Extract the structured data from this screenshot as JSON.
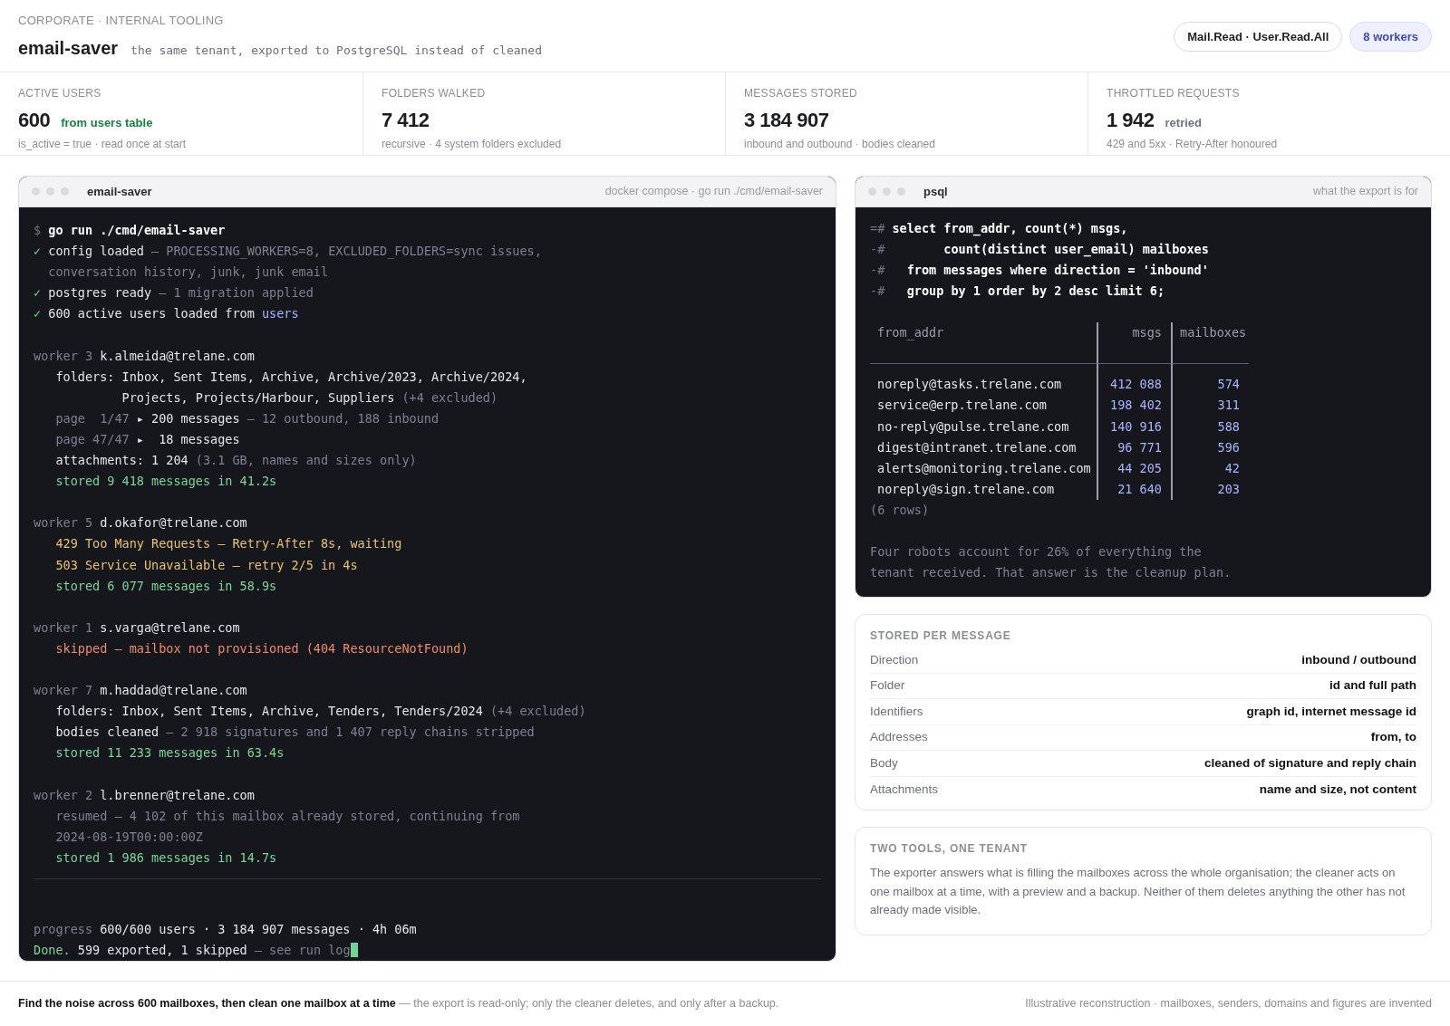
{
  "header": {
    "eyebrow": "CORPORATE · INTERNAL TOOLING",
    "title": "email-saver",
    "subtitle": "the same tenant, exported to PostgreSQL instead of cleaned",
    "badges": [
      {
        "label": "Mail.Read · User.Read.All",
        "kind": "neutral"
      },
      {
        "label": "8 workers",
        "kind": "accent"
      }
    ]
  },
  "stats": [
    {
      "label": "ACTIVE USERS",
      "value": "600",
      "tag": {
        "text": "from users table",
        "kind": "ok"
      },
      "sub": "is_active = true · read once at start"
    },
    {
      "label": "FOLDERS WALKED",
      "value": "7 412",
      "sub": "recursive · 4 system folders excluded"
    },
    {
      "label": "MESSAGES STORED",
      "value": "3 184 907",
      "sub": "inbound and outbound · bodies cleaned"
    },
    {
      "label": "THROTTLED REQUESTS",
      "value": "1 942",
      "tag": {
        "text": "retried",
        "kind": "muted"
      },
      "sub": "429 and 5xx · Retry-After honoured"
    }
  ],
  "terminal": {
    "title": "email-saver",
    "caption": "docker compose · go run ./cmd/email-saver",
    "blocks": [
      {
        "kind": "log",
        "lines": [
          {
            "kind": "top",
            "segments": [
              {
                "text": "$ ",
                "kind": "prompt"
              },
              {
                "text": "go run ./cmd/email-saver",
                "kind": "cmd"
              }
            ]
          },
          {
            "kind": "top",
            "segments": [
              {
                "text": "✓ ",
                "kind": "ok"
              },
              {
                "text": "config loaded ",
                "kind": "text"
              },
              {
                "text": "— PROCESSING_WORKERS=8, EXCLUDED_FOLDERS=sync issues,",
                "kind": "dim"
              }
            ]
          },
          {
            "kind": "wrap",
            "segments": [
              {
                "text": "conversation history, junk, junk email",
                "kind": "dim"
              }
            ]
          },
          {
            "kind": "top",
            "segments": [
              {
                "text": "✓ ",
                "kind": "ok"
              },
              {
                "text": "postgres ready ",
                "kind": "text"
              },
              {
                "text": "— 1 migration applied",
                "kind": "dim"
              }
            ]
          },
          {
            "kind": "top",
            "segments": [
              {
                "text": "✓ ",
                "kind": "ok"
              },
              {
                "text": "600 active users loaded from ",
                "kind": "text"
              },
              {
                "text": "users",
                "kind": "link"
              }
            ]
          }
        ]
      },
      {
        "kind": "log",
        "lines": [
          {
            "kind": "top",
            "segments": [
              {
                "text": "worker 3 ",
                "kind": "dim"
              },
              {
                "text": "k.almeida@trelane.com",
                "kind": "text"
              }
            ]
          },
          {
            "kind": "sub",
            "segments": [
              {
                "text": "folders: Inbox, Sent Items, Archive, Archive/2023, Archive/2024,",
                "kind": "text"
              }
            ]
          },
          {
            "kind": "subwrap",
            "segments": [
              {
                "text": "Projects, Projects/Harbour, Suppliers ",
                "kind": "text"
              },
              {
                "text": "(+4 excluded)",
                "kind": "dim"
              }
            ]
          },
          {
            "kind": "sub",
            "segments": [
              {
                "text": "page  1/47 ",
                "kind": "dim"
              },
              {
                "text": "▸ 200 messages ",
                "kind": "text"
              },
              {
                "text": "— 12 outbound, 188 inbound",
                "kind": "dim"
              }
            ]
          },
          {
            "kind": "sub",
            "segments": [
              {
                "text": "page 47/47 ",
                "kind": "dim"
              },
              {
                "text": "▸  18 messages",
                "kind": "text"
              }
            ]
          },
          {
            "kind": "sub",
            "segments": [
              {
                "text": "attachments: 1 204 ",
                "kind": "text"
              },
              {
                "text": "(3.1 GB, names and sizes only)",
                "kind": "dim"
              }
            ]
          },
          {
            "kind": "sub",
            "segments": [
              {
                "text": "stored 9 418 messages in 41.2s",
                "kind": "ok"
              }
            ]
          }
        ]
      },
      {
        "kind": "log",
        "lines": [
          {
            "kind": "top",
            "segments": [
              {
                "text": "worker 5 ",
                "kind": "dim"
              },
              {
                "text": "d.okafor@trelane.com",
                "kind": "text"
              }
            ]
          },
          {
            "kind": "sub",
            "segments": [
              {
                "text": "429 Too Many Requests — Retry-After 8s, waiting",
                "kind": "warn"
              }
            ]
          },
          {
            "kind": "sub",
            "segments": [
              {
                "text": "503 Service Unavailable — retry 2/5 in 4s",
                "kind": "warn"
              }
            ]
          },
          {
            "kind": "sub",
            "segments": [
              {
                "text": "stored 6 077 messages in 58.9s",
                "kind": "ok"
              }
            ]
          }
        ]
      },
      {
        "kind": "log",
        "lines": [
          {
            "kind": "top",
            "segments": [
              {
                "text": "worker 1 ",
                "kind": "dim"
              },
              {
                "text": "s.varga@trelane.com",
                "kind": "text"
              }
            ]
          },
          {
            "kind": "sub",
            "segments": [
              {
                "text": "skipped — mailbox not provisioned (404 ResourceNotFound)",
                "kind": "err"
              }
            ]
          }
        ]
      },
      {
        "kind": "log",
        "lines": [
          {
            "kind": "top",
            "segments": [
              {
                "text": "worker 7 ",
                "kind": "dim"
              },
              {
                "text": "m.haddad@trelane.com",
                "kind": "text"
              }
            ]
          },
          {
            "kind": "sub",
            "segments": [
              {
                "text": "folders: Inbox, Sent Items, Archive, Tenders, Tenders/2024 ",
                "kind": "text"
              },
              {
                "text": "(+4 excluded)",
                "kind": "dim"
              }
            ]
          },
          {
            "kind": "sub",
            "segments": [
              {
                "text": "bodies cleaned ",
                "kind": "text"
              },
              {
                "text": "— 2 918 signatures and 1 407 reply chains stripped",
                "kind": "dim"
              }
            ]
          },
          {
            "kind": "sub",
            "segments": [
              {
                "text": "stored 11 233 messages in 63.4s",
                "kind": "ok"
              }
            ]
          }
        ]
      },
      {
        "kind": "log",
        "lines": [
          {
            "kind": "top",
            "segments": [
              {
                "text": "worker 2 ",
                "kind": "dim"
              },
              {
                "text": "l.brenner@trelane.com",
                "kind": "text"
              }
            ]
          },
          {
            "kind": "sub",
            "segments": [
              {
                "text": "resumed — 4 102 of this mailbox already stored, continuing from",
                "kind": "dim"
              }
            ]
          },
          {
            "kind": "sub",
            "segments": [
              {
                "text": "2024-08-19T00:00:00Z",
                "kind": "dim"
              }
            ]
          },
          {
            "kind": "sub",
            "segments": [
              {
                "text": "stored 1 986 messages in 14.7s",
                "kind": "ok"
              }
            ]
          }
        ]
      },
      {
        "kind": "summary",
        "cursor": true,
        "lines": [
          {
            "kind": "top",
            "segments": [
              {
                "text": "progress ",
                "kind": "dim"
              },
              {
                "text": "600/600 users · 3 184 907 messages · 4h 06m",
                "kind": "text"
              }
            ]
          },
          {
            "kind": "top",
            "segments": [
              {
                "text": "Done. ",
                "kind": "ok"
              },
              {
                "text": "599 exported, 1 skipped ",
                "kind": "text"
              },
              {
                "text": "— see run log",
                "kind": "dim"
              }
            ]
          }
        ]
      }
    ]
  },
  "psql": {
    "title": "psql",
    "caption": "what the export is for",
    "query": [
      {
        "prompt": "=#",
        "kind": "flat",
        "text": "select from_addr, count(*) msgs,"
      },
      {
        "prompt": "-#",
        "kind": "deep",
        "text": "count(distinct user_email) mailboxes"
      },
      {
        "prompt": "-#",
        "kind": "shallow",
        "text": "from messages where direction = 'inbound'"
      },
      {
        "prompt": "-#",
        "kind": "shallow",
        "text": "group by 1 order by 2 desc limit 6;"
      }
    ],
    "columns": [
      "from_addr",
      "msgs",
      "mailboxes"
    ],
    "rows": [
      [
        "noreply@tasks.trelane.com",
        "412 088",
        "574"
      ],
      [
        "service@erp.trelane.com",
        "198 402",
        "311"
      ],
      [
        "no-reply@pulse.trelane.com",
        "140 916",
        "588"
      ],
      [
        "digest@intranet.trelane.com",
        "96 771",
        "596"
      ],
      [
        "alerts@monitoring.trelane.com",
        "44 205",
        "42"
      ],
      [
        "noreply@sign.trelane.com",
        "21 640",
        "203"
      ]
    ],
    "row_count": "(6 rows)",
    "note": "Four robots account for 26% of everything the tenant received. That answer is the cleanup plan."
  },
  "stored": {
    "title": "STORED PER MESSAGE",
    "rows": [
      {
        "label": "Direction",
        "value": "inbound / outbound"
      },
      {
        "label": "Folder",
        "value": "id and full path"
      },
      {
        "label": "Identifiers",
        "value": "graph id, internet message id"
      },
      {
        "label": "Addresses",
        "value": "from, to"
      },
      {
        "label": "Body",
        "value": "cleaned of signature and reply chain"
      },
      {
        "label": "Attachments",
        "value": "name and size, not content"
      }
    ]
  },
  "tools": {
    "title": "TWO TOOLS, ONE TENANT",
    "text": "The exporter answers what is filling the mailboxes across the whole organisation; the cleaner acts on one mailbox at a time, with a preview and a backup. Neither of them deletes anything the other has not already made visible."
  },
  "footer": {
    "lead": "Find the noise across 600 mailboxes, then clean one mailbox at a time",
    "rest": "— the export is read-only; only the cleaner deletes, and only after a backup.",
    "note": "Illustrative reconstruction · mailboxes, senders, domains and figures are invented"
  }
}
